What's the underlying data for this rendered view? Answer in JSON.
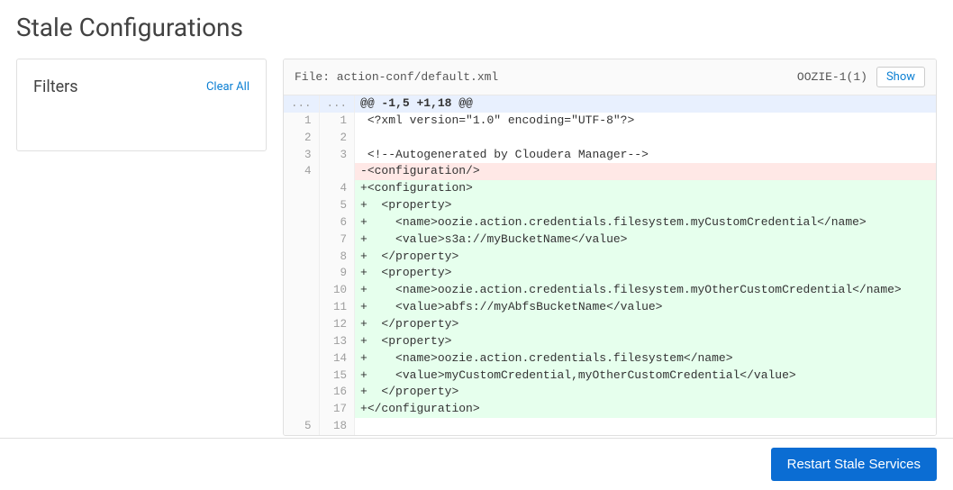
{
  "page": {
    "title": "Stale Configurations"
  },
  "filters": {
    "title": "Filters",
    "clear_all": "Clear All"
  },
  "diff": {
    "file_label": "File: action-conf/default.xml",
    "service_label": "OOZIE-1(1)",
    "show_button": "Show",
    "lines": [
      {
        "type": "hunk",
        "old": "...",
        "new": "...",
        "text": "@@ -1,5 +1,18 @@"
      },
      {
        "type": "ctx",
        "old": "1",
        "new": "1",
        "text": " <?xml version=\"1.0\" encoding=\"UTF-8\"?>"
      },
      {
        "type": "ctx",
        "old": "2",
        "new": "2",
        "text": " "
      },
      {
        "type": "ctx",
        "old": "3",
        "new": "3",
        "text": " <!--Autogenerated by Cloudera Manager-->"
      },
      {
        "type": "del",
        "old": "4",
        "new": "",
        "text": "-<configuration/>"
      },
      {
        "type": "add",
        "old": "",
        "new": "4",
        "text": "+<configuration>"
      },
      {
        "type": "add",
        "old": "",
        "new": "5",
        "text": "+  <property>"
      },
      {
        "type": "add",
        "old": "",
        "new": "6",
        "text": "+    <name>oozie.action.credentials.filesystem.myCustomCredential</name>"
      },
      {
        "type": "add",
        "old": "",
        "new": "7",
        "text": "+    <value>s3a://myBucketName</value>"
      },
      {
        "type": "add",
        "old": "",
        "new": "8",
        "text": "+  </property>"
      },
      {
        "type": "add",
        "old": "",
        "new": "9",
        "text": "+  <property>"
      },
      {
        "type": "add",
        "old": "",
        "new": "10",
        "text": "+    <name>oozie.action.credentials.filesystem.myOtherCustomCredential</name>"
      },
      {
        "type": "add",
        "old": "",
        "new": "11",
        "text": "+    <value>abfs://myAbfsBucketName</value>"
      },
      {
        "type": "add",
        "old": "",
        "new": "12",
        "text": "+  </property>"
      },
      {
        "type": "add",
        "old": "",
        "new": "13",
        "text": "+  <property>"
      },
      {
        "type": "add",
        "old": "",
        "new": "14",
        "text": "+    <name>oozie.action.credentials.filesystem</name>"
      },
      {
        "type": "add",
        "old": "",
        "new": "15",
        "text": "+    <value>myCustomCredential,myOtherCustomCredential</value>"
      },
      {
        "type": "add",
        "old": "",
        "new": "16",
        "text": "+  </property>"
      },
      {
        "type": "add",
        "old": "",
        "new": "17",
        "text": "+</configuration>"
      },
      {
        "type": "ctx",
        "old": "5",
        "new": "18",
        "text": " "
      }
    ]
  },
  "footer": {
    "restart_button": "Restart Stale Services"
  }
}
